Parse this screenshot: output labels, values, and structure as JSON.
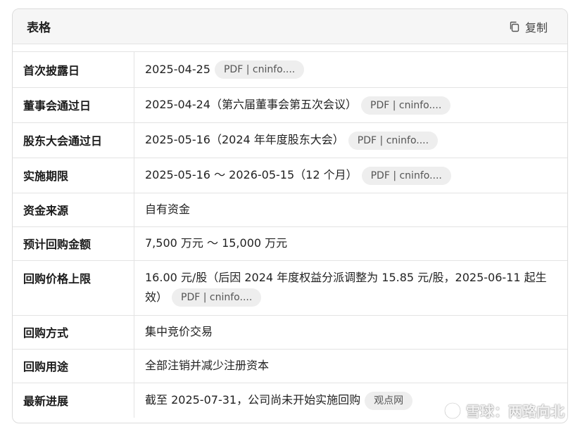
{
  "header": {
    "title": "表格",
    "copy_label": "复制",
    "copy_icon": "copy-icon"
  },
  "rows": [
    {
      "label": "首次披露日",
      "value": "2025-04-25",
      "source": "PDF | cninfo...."
    },
    {
      "label": "董事会通过日",
      "value": "2025-04-24（第六届董事会第五次会议）",
      "source": "PDF | cninfo...."
    },
    {
      "label": "股东大会通过日",
      "value": "2025-05-16（2024 年年度股东大会）",
      "source": "PDF | cninfo...."
    },
    {
      "label": "实施期限",
      "value": "2025-05-16 ～ 2026-05-15（12 个月）",
      "source": "PDF | cninfo...."
    },
    {
      "label": "资金来源",
      "value": "自有资金"
    },
    {
      "label": "预计回购金额",
      "value": "7,500 万元 ～ 15,000 万元"
    },
    {
      "label": "回购价格上限",
      "value": "16.00 元/股（后因 2024 年度权益分派调整为 15.85 元/股，2025-06-11 起生效）",
      "source": "PDF | cninfo...."
    },
    {
      "label": "回购方式",
      "value": "集中竞价交易"
    },
    {
      "label": "回购用途",
      "value": "全部注销并减少注册资本"
    },
    {
      "label": "最新进展",
      "value": "截至 2025-07-31，公司尚未开始实施回购",
      "source": "观点网"
    }
  ],
  "watermark": {
    "text": "雪球：两路向北",
    "icon": "snowball-logo-icon"
  }
}
